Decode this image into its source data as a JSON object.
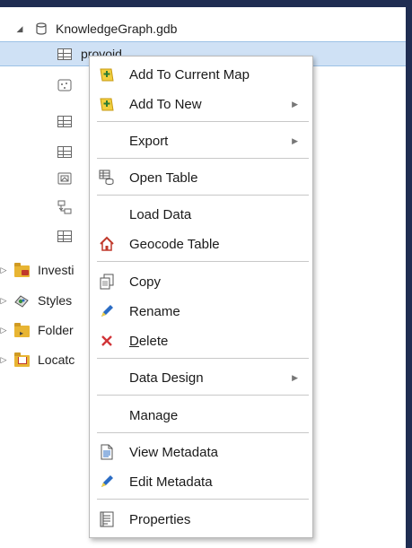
{
  "tree": {
    "gdb_name": "KnowledgeGraph.gdb",
    "selected_item": "provoid",
    "items": [
      {
        "label": "Investi"
      },
      {
        "label": "Styles"
      },
      {
        "label": "Folder"
      },
      {
        "label": "Locatc"
      }
    ]
  },
  "menu": {
    "add_to_current_map": "Add To Current Map",
    "add_to_new": "Add To New",
    "export": "Export",
    "open_table": "Open Table",
    "load_data": "Load Data",
    "geocode_table": "Geocode Table",
    "copy": "Copy",
    "rename": "Rename",
    "delete_first": "D",
    "delete_rest": "elete",
    "data_design": "Data Design",
    "manage": "Manage",
    "view_metadata": "View Metadata",
    "edit_metadata": "Edit Metadata",
    "properties": "Properties"
  },
  "colors": {
    "background": "#1f2d52",
    "selection": "#cfe1f5",
    "accent_blue": "#2b6cc4",
    "delete_red": "#d13438",
    "folder_yellow": "#e8b533"
  }
}
